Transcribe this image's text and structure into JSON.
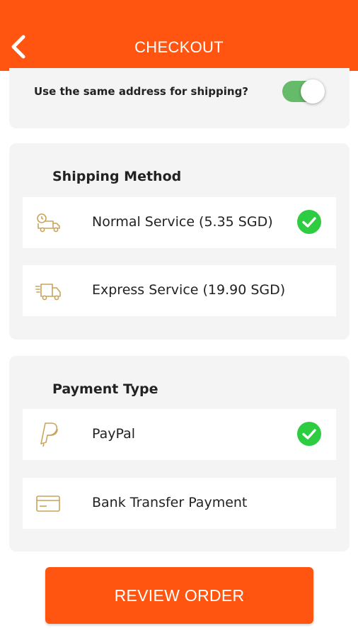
{
  "header": {
    "title": "CHECKOUT",
    "back_icon": "chevron-left-icon",
    "color": "#ff5511"
  },
  "address": {
    "same_address_label": "Use the same address for shipping?",
    "same_address_enabled": true,
    "toggle_color": "#66bb6a"
  },
  "shipping": {
    "title": "Shipping Method",
    "options": [
      {
        "label": "Normal Service (5.35 SGD)",
        "icon": "delivery-truck-clock-icon",
        "selected": true
      },
      {
        "label": "Express Service (19.90 SGD)",
        "icon": "express-truck-icon",
        "selected": false
      }
    ]
  },
  "payment": {
    "title": "Payment Type",
    "options": [
      {
        "label": "PayPal",
        "icon": "paypal-icon",
        "selected": true
      },
      {
        "label": "Bank Transfer Payment",
        "icon": "credit-card-icon",
        "selected": false
      }
    ]
  },
  "review_button": {
    "label": "REVIEW ORDER"
  },
  "colors": {
    "accent": "#ff5511",
    "check": "#2ecc40",
    "icon": "#c9a45c"
  }
}
